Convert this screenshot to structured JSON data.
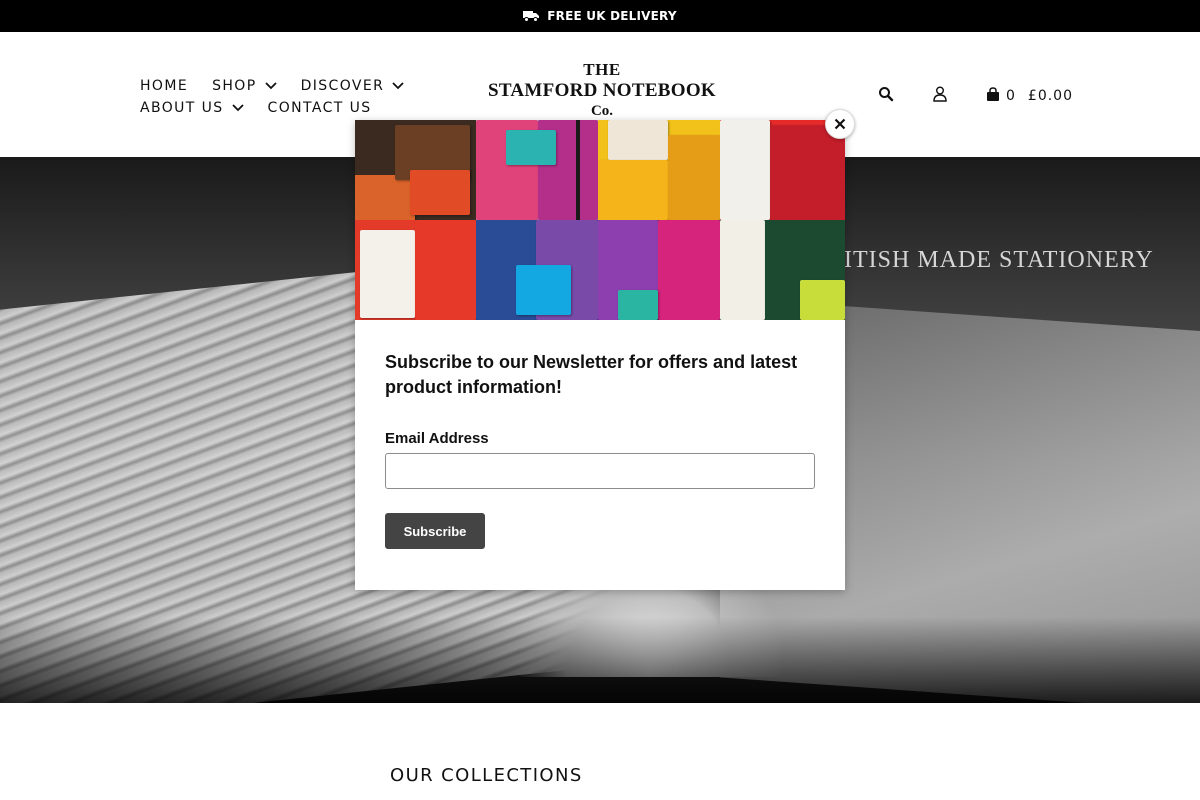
{
  "announcement": {
    "text": "FREE UK DELIVERY",
    "icon": "truck-icon"
  },
  "nav": {
    "items": [
      {
        "label": "HOME",
        "has_dropdown": false
      },
      {
        "label": "SHOP",
        "has_dropdown": true
      },
      {
        "label": "DISCOVER",
        "has_dropdown": true
      },
      {
        "label": "ABOUT US",
        "has_dropdown": true
      },
      {
        "label": "CONTACT US",
        "has_dropdown": false
      }
    ]
  },
  "logo": {
    "line1": "THE",
    "line2": "STAMFORD NOTEBOOK",
    "line3": "Co."
  },
  "header_tools": {
    "search_icon": "search-icon",
    "account_icon": "user-icon",
    "cart_icon": "bag-icon",
    "cart_count": "0",
    "cart_total": "£0.00"
  },
  "hero": {
    "title": "BRITISH MADE STATIONERY"
  },
  "collections": {
    "title": "OUR COLLECTIONS"
  },
  "modal": {
    "heading": "Subscribe to our Newsletter for offers and latest product information!",
    "email_label": "Email Address",
    "email_value": "",
    "email_placeholder": "",
    "subscribe_label": "Subscribe",
    "close_icon": "close-icon"
  },
  "colors": {
    "announce_bg": "#000000",
    "button_bg": "#444444",
    "hero_tone": "#5b5b5b"
  }
}
